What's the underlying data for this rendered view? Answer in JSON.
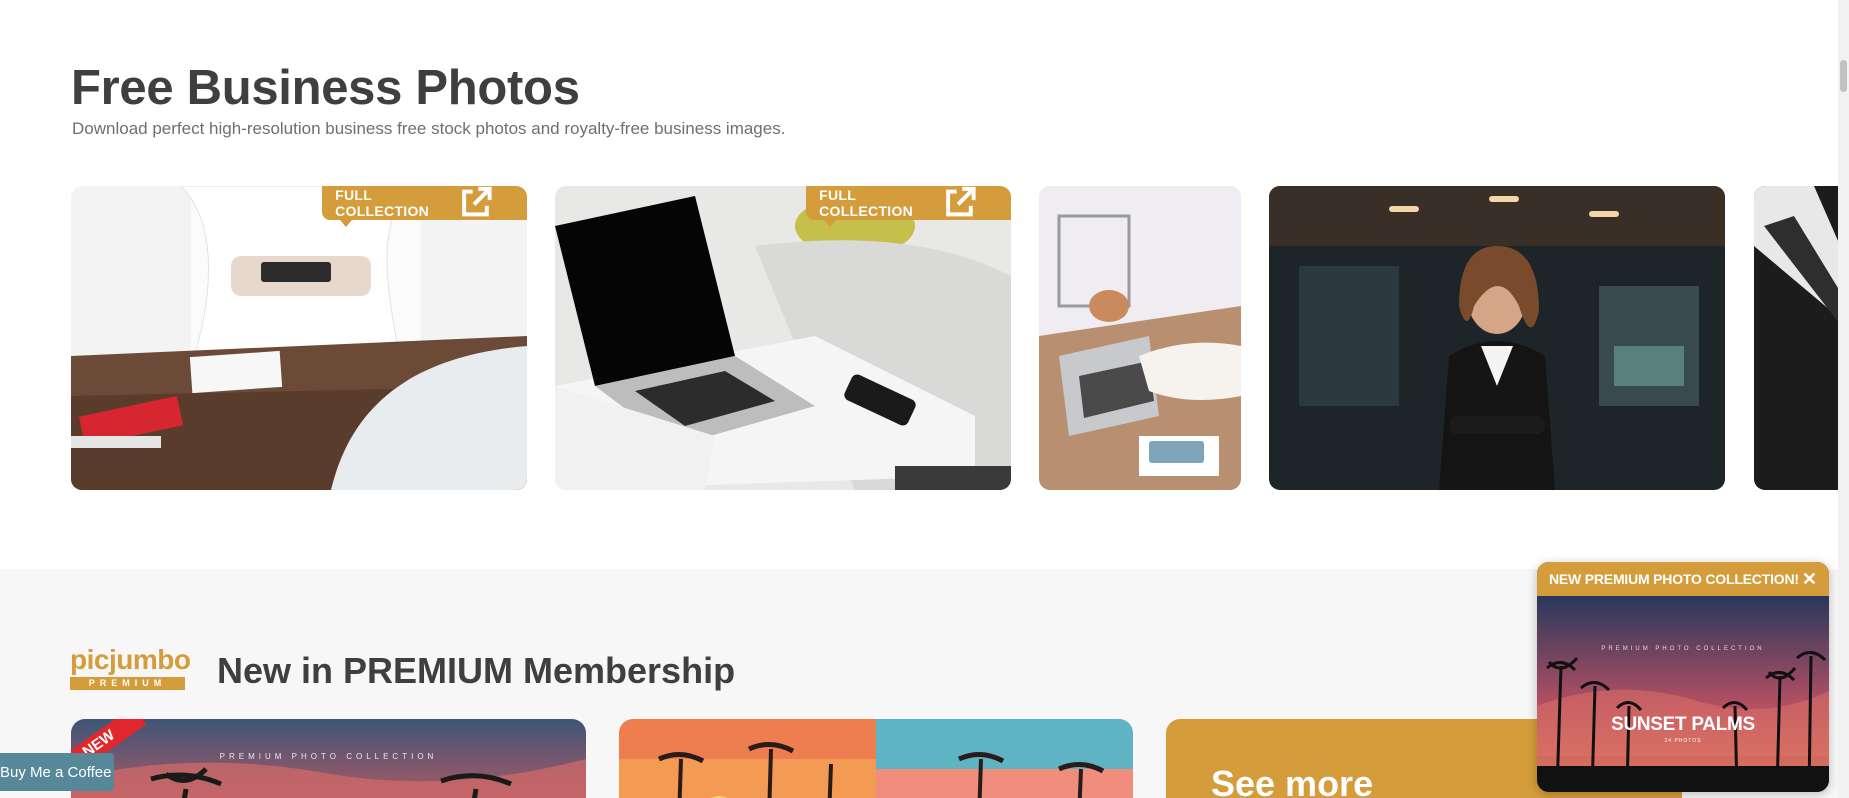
{
  "business": {
    "title": "Free Business Photos",
    "subtitle": "Download perfect high-resolution business free stock photos and royalty-free business images.",
    "full_collection_label": "FULL COLLECTION"
  },
  "premium": {
    "logo_word": "picjumbo",
    "logo_badge": "PREMIUM",
    "heading": "New in PREMIUM Membership",
    "new_ribbon": "NEW",
    "card_kicker": "PREMIUM PHOTO COLLECTION",
    "see_more": "See more"
  },
  "buy_me_a_coffee": "Buy Me a Coffee",
  "popup": {
    "title": "NEW PREMIUM PHOTO COLLECTION!",
    "close_symbol": "✕",
    "kicker": "PREMIUM PHOTO COLLECTION",
    "name": "SUNSET PALMS",
    "count": "24 PHOTOS"
  },
  "colors": {
    "accent": "#d49c3a",
    "new_ribbon": "#e1262c",
    "bmc_button": "#56889a",
    "heading": "#3f3f3f"
  },
  "icons": [
    "external-link-icon",
    "close-icon"
  ]
}
